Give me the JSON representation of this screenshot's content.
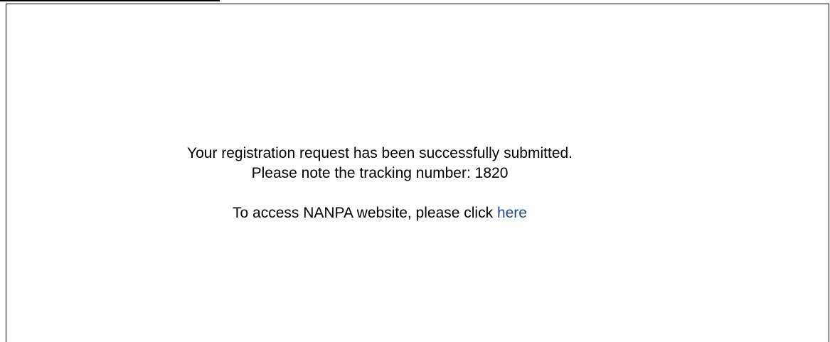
{
  "message": {
    "line1": "Your registration request has been successfully submitted.",
    "line2_prefix": "Please note the tracking number:",
    "tracking_number": "1820",
    "line3_prefix": "To access NANPA website, please click",
    "link_text": "here"
  }
}
